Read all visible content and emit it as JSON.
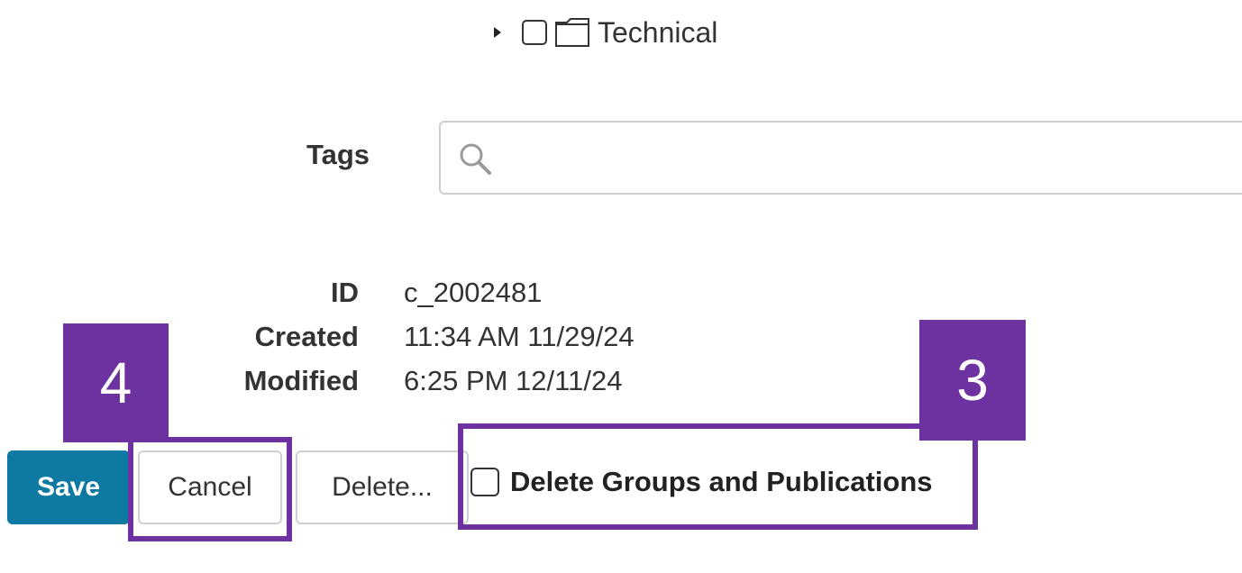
{
  "tree": {
    "item_label": "Technical",
    "checked": false
  },
  "tags": {
    "label": "Tags",
    "placeholder": "",
    "value": ""
  },
  "metadata": {
    "id_label": "ID",
    "id_value": "c_2002481",
    "created_label": "Created",
    "created_value": "11:34 AM 11/29/24",
    "modified_label": "Modified",
    "modified_value": "6:25 PM 12/11/24"
  },
  "actions": {
    "save_label": "Save",
    "cancel_label": "Cancel",
    "delete_label": "Delete...",
    "delete_groups_label": "Delete Groups and Publications",
    "delete_groups_checked": false
  },
  "callouts": {
    "cancel_number": "4",
    "delete_groups_number": "3"
  },
  "colors": {
    "primary_button": "#0e7aa3",
    "callout": "#6e32a0",
    "border": "#d0d0d0",
    "text": "#333333"
  },
  "icons": [
    "caret-right-icon",
    "checkbox-icon",
    "folder-icon",
    "search-icon"
  ]
}
